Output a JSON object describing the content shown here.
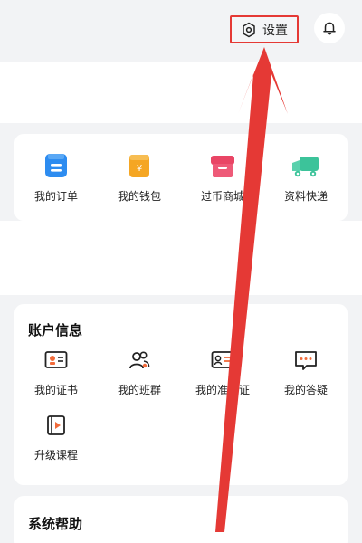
{
  "header": {
    "settings_label": "设置",
    "settings_icon": "settings-icon",
    "bell_icon": "bell-icon"
  },
  "quick_links": [
    {
      "label": "我的订单",
      "icon": "order-icon",
      "color": "#2d8cf0"
    },
    {
      "label": "我的钱包",
      "icon": "wallet-icon",
      "color": "#f5a623"
    },
    {
      "label": "过币商城",
      "icon": "store-icon",
      "color": "#e94565"
    },
    {
      "label": "资料快递",
      "icon": "truck-icon",
      "color": "#3cc39a"
    }
  ],
  "account": {
    "title": "账户信息",
    "items": [
      {
        "label": "我的证书",
        "icon": "certificate-icon"
      },
      {
        "label": "我的班群",
        "icon": "group-icon"
      },
      {
        "label": "我的准考证",
        "icon": "admission-card-icon"
      },
      {
        "label": "我的答疑",
        "icon": "qa-icon"
      },
      {
        "label": "升级课程",
        "icon": "upgrade-course-icon"
      }
    ]
  },
  "help": {
    "title": "系统帮助"
  },
  "colors": {
    "annotation": "#e53935",
    "accent_orange": "#f26b3a"
  }
}
